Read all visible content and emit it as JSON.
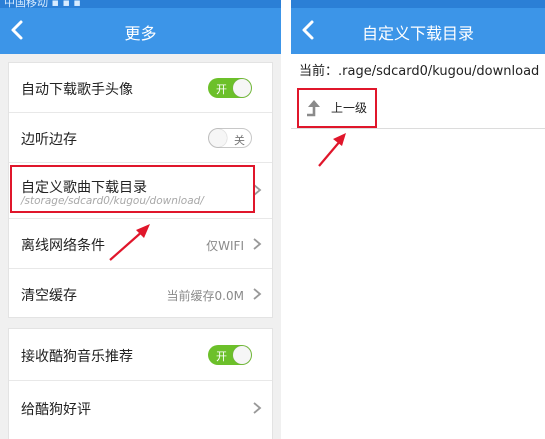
{
  "left": {
    "title": "更多",
    "card1": [
      {
        "label": "自动下载歌手头像",
        "toggle": "开"
      },
      {
        "label": "边听边存",
        "toggle": "关"
      },
      {
        "label": "自定义歌曲下载目录",
        "sub": "/storage/sdcard0/kugou/download/"
      },
      {
        "label": "离线网络条件",
        "value": "仅WIFI"
      },
      {
        "label": "清空缓存",
        "value": "当前缓存0.0M"
      }
    ],
    "card2": [
      {
        "label": "接收酷狗音乐推荐",
        "toggle": "开"
      },
      {
        "label": "给酷狗好评"
      }
    ]
  },
  "right": {
    "title": "自定义下载目录",
    "current_path": "当前：.rage/sdcard0/kugou/download",
    "up_label": "上一级"
  },
  "colors": {
    "titlebar": "#3c95e8",
    "toggle_on": "#6cc02a",
    "highlight": "#e0162b"
  }
}
